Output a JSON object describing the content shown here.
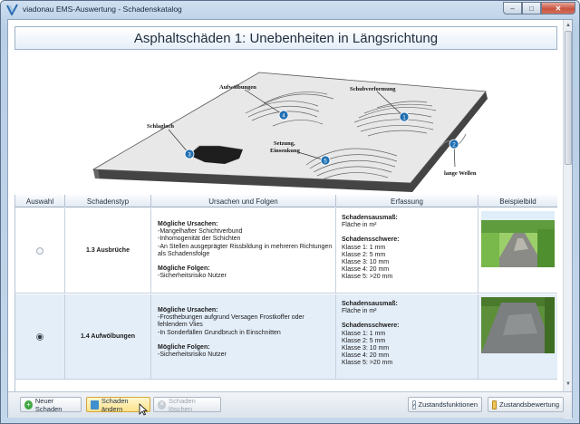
{
  "window": {
    "title": "viadonau EMS-Auswertung - Schadenskatalog",
    "controls": {
      "minimize": "–",
      "maximize": "□",
      "close": "✕"
    }
  },
  "header": {
    "title": "Asphaltschäden 1: Unebenheiten in Längsrichtung"
  },
  "diagram": {
    "labels": {
      "aufwoelbungen": "Aufwölbungen",
      "schubverformung": "Schubverformung",
      "schlagloch": "Schlagloch",
      "setzung": "Setzung,",
      "einsenkung": "Einsenkung",
      "lange_wellen": "lange Wellen"
    },
    "markers": {
      "m1": "1",
      "m2": "2",
      "m3": "3",
      "m4": "4",
      "m5": "5"
    }
  },
  "table": {
    "columns": [
      "Auswahl",
      "Schadenstyp",
      "Ursachen und Folgen",
      "Erfassung",
      "Beispielbild"
    ],
    "rows": [
      {
        "selected": false,
        "type": "1.3 Ausbrüche",
        "causes_title": "Mögliche Ursachen:",
        "causes": [
          "-Mangelhafter Schichtverbund",
          "-Inhomogenität der Schichten",
          "-An Stellen ausgeprägter Rissbildung in mehreren Richtungen als Schadensfolge"
        ],
        "consequences_title": "Mögliche Folgen:",
        "consequences": [
          "-Sicherheitsrisiko Nutzer"
        ],
        "measure_title": "Schadensausmaß:",
        "measure": "Fläche in m²",
        "severity_title": "Schadensschwere:",
        "severity": [
          "Klasse 1: 1 mm",
          "Klasse 2: 5 mm",
          "Klasse 3: 10 mm",
          "Klasse 4: 20 mm",
          "Klasse 5: >20 mm"
        ]
      },
      {
        "selected": true,
        "type": "1.4 Aufwölbungen",
        "causes_title": "Mögliche Ursachen:",
        "causes": [
          "-Frosthebungen aufgrund Versagen Frostkoffer oder fehlendem Vlies",
          "-In Sonderfällen Grundbruch in Einschnitten"
        ],
        "consequences_title": "Mögliche Folgen:",
        "consequences": [
          "-Sicherheitsrisiko Nutzer"
        ],
        "measure_title": "Schadensausmaß:",
        "measure": "Fläche in m²",
        "severity_title": "Schadensschwere:",
        "severity": [
          "Klasse 1: 1 mm",
          "Klasse 2: 5 mm",
          "Klasse 3: 10 mm",
          "Klasse 4: 20 mm",
          "Klasse 5: >20 mm"
        ]
      }
    ]
  },
  "toolbar": {
    "new_label": "Neuer Schaden",
    "edit_label": "Schaden ändern",
    "delete_label": "Schaden löschen",
    "status_functions_label": "Zustandsfunktionen",
    "status_rating_label": "Zustandsbewertung"
  },
  "colors": {
    "accent": "#2b6cb0",
    "marker": "#1f6fb2",
    "selected_row": "#e4eef9"
  }
}
